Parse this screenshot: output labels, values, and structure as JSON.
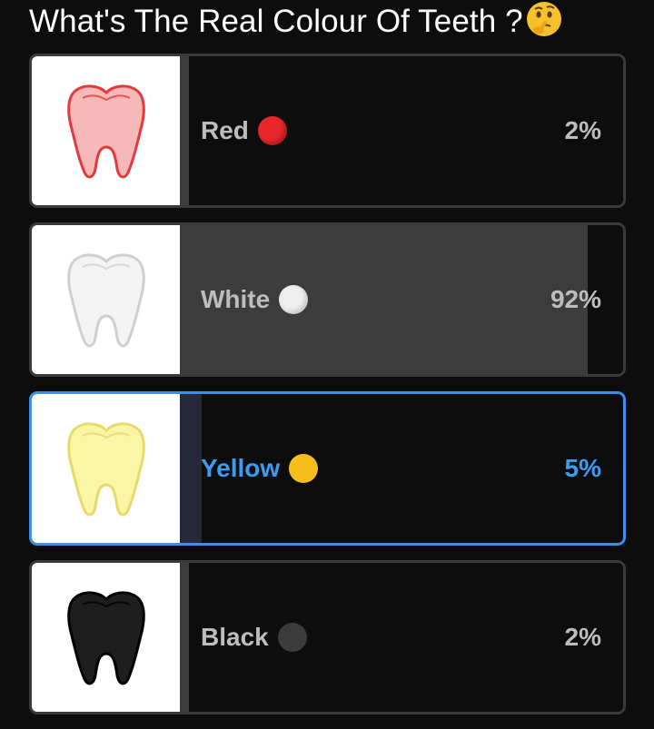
{
  "poll": {
    "question": "What's The Real Colour Of Teeth ?",
    "question_emoji": "thinking-face-icon",
    "options": [
      {
        "label": "Red",
        "emoji": "red-circle-icon",
        "dot_color": "#e8262b",
        "tooth_fill": "#f6b8b8",
        "tooth_stroke": "#e33b3b",
        "percent_text": "2%",
        "percent": 2,
        "selected": false
      },
      {
        "label": "White",
        "emoji": "white-circle-icon",
        "dot_color": "#eeeeee",
        "tooth_fill": "#f4f4f4",
        "tooth_stroke": "#cfcfcf",
        "percent_text": "92%",
        "percent": 92,
        "selected": false
      },
      {
        "label": "Yellow",
        "emoji": "yellow-circle-icon",
        "dot_color": "#f6be1a",
        "tooth_fill": "#fbf6a6",
        "tooth_stroke": "#e9d86a",
        "percent_text": "5%",
        "percent": 5,
        "selected": true
      },
      {
        "label": "Black",
        "emoji": "black-circle-icon",
        "dot_color": "#3b3b3b",
        "tooth_fill": "#1e1e1e",
        "tooth_stroke": "#000000",
        "percent_text": "2%",
        "percent": 2,
        "selected": false
      }
    ]
  },
  "colors": {
    "background": "#0d0d0d",
    "selected_accent": "#3d8fe8",
    "result_bar": "#3c3c3c"
  }
}
